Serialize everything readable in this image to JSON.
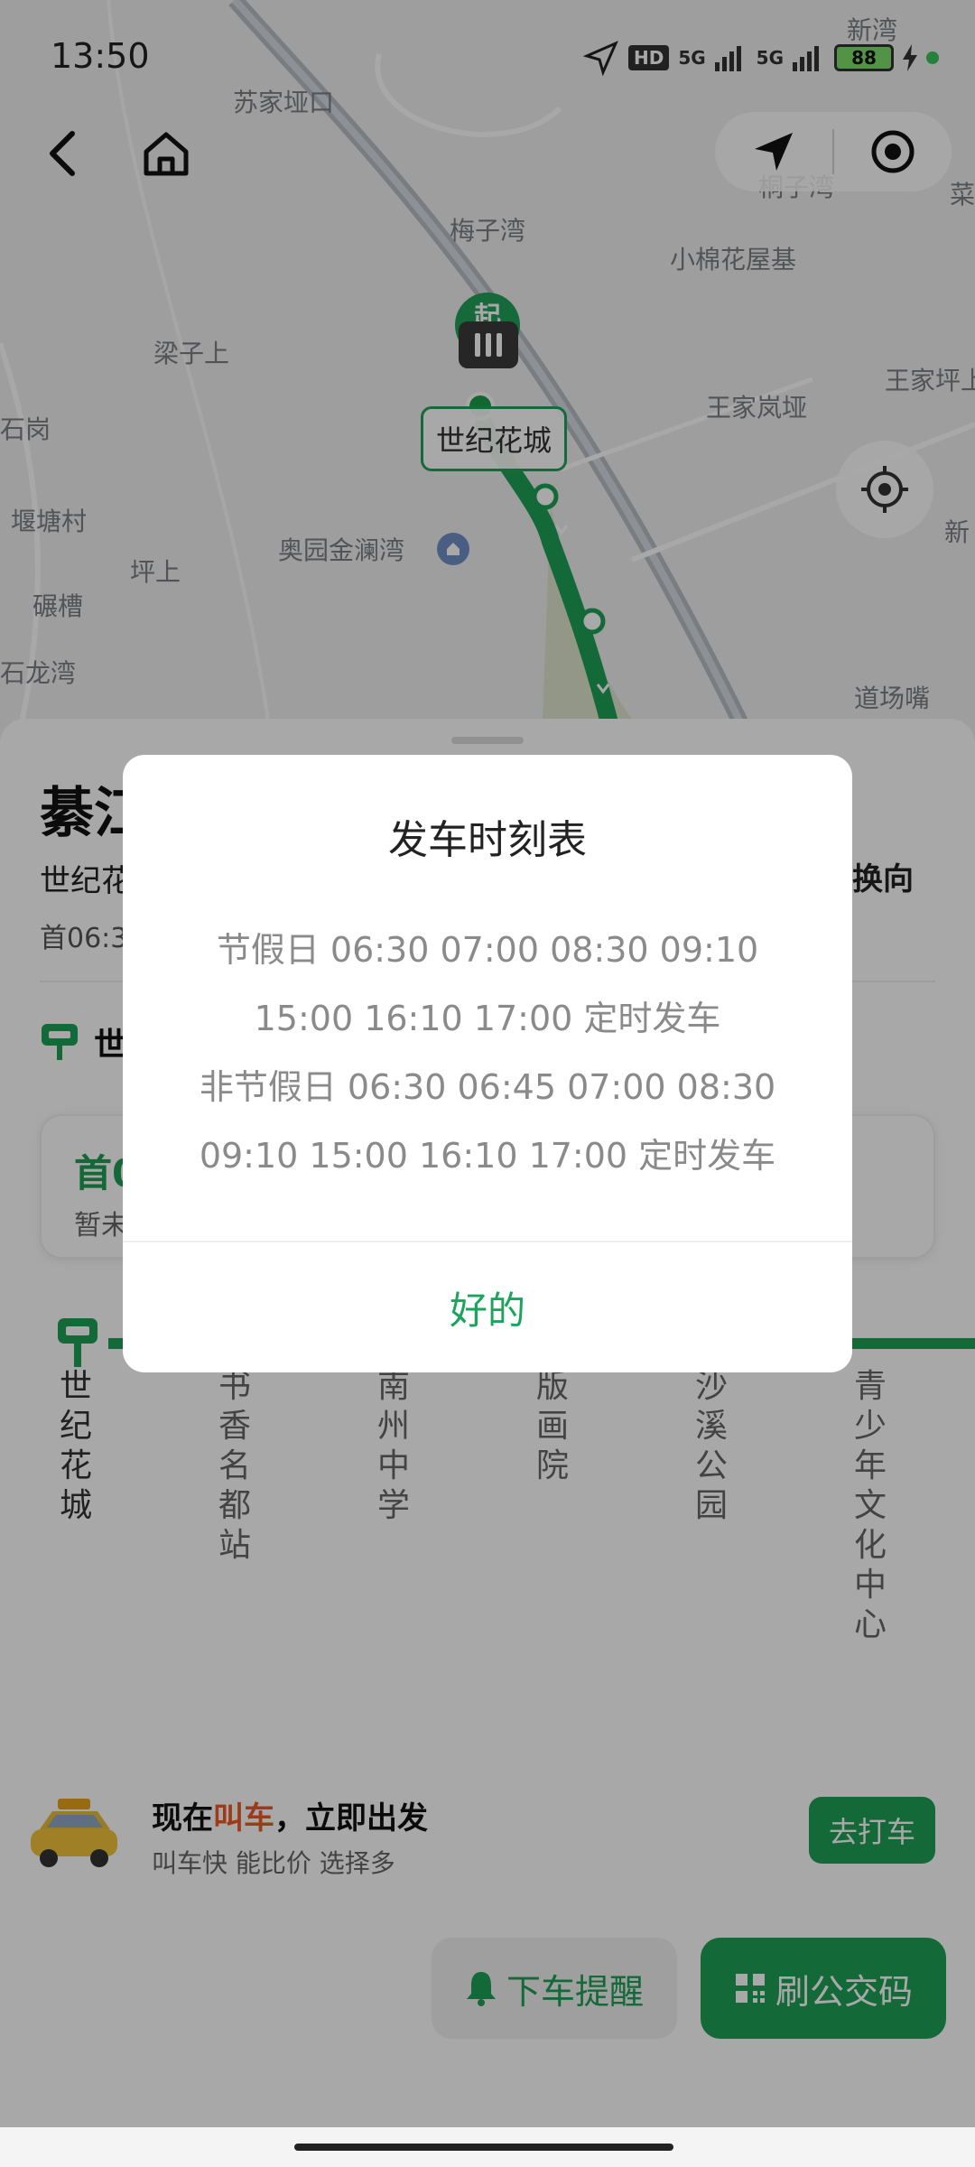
{
  "status_bar": {
    "time": "13:50",
    "net_hd": "HD",
    "net_5g_1": "5G",
    "net_5g_2": "5G",
    "battery": "88"
  },
  "map": {
    "labels": {
      "xinwan": "新湾",
      "sujiaba": "苏家垭口",
      "tongziwan": "桐子湾",
      "meiziwan": "梅子湾",
      "xiaomian": "小棉花屋基",
      "liangzi": "梁子上",
      "wangjia_ping": "王家坪上",
      "wangjialan": "王家岚垭",
      "shigang": "石岗",
      "yantang": "堰塘村",
      "aoyuan": "奥园金澜湾",
      "pingshang": "坪上",
      "nianicao": "碾槽",
      "shilongwan": "石龙湾",
      "daochang": "道场嘴",
      "cai": "菜",
      "xin": "新"
    },
    "start_marker": "起",
    "current_station": "世纪花城"
  },
  "sheet": {
    "route_name": "綦江",
    "route_direction": "世纪花",
    "switch_direction": "换向",
    "first_last": "首06:3",
    "board_stop": "世",
    "arrival_title": "首0",
    "arrival_sub": "暂未",
    "stops": [
      "世纪花城",
      "书香名都站",
      "南州中学",
      "版画院",
      "沙溪公园",
      "青少年文化中心"
    ]
  },
  "taxi": {
    "title_before": "现在",
    "title_highlight": "叫车",
    "title_after": "，立即出发",
    "subtitle": "叫车快 能比价 选择多",
    "button": "去打车"
  },
  "actions": {
    "remind": "下车提醒",
    "qr": "刷公交码"
  },
  "dialog": {
    "title": "发车时刻表",
    "lines": [
      "节假日 06:30 07:00 08:30 09:10",
      "15:00 16:10 17:00 定时发车",
      "非节假日 06:30 06:45 07:00 08:30",
      "09:10 15:00 16:10 17:00 定时发车"
    ],
    "ok": "好的"
  },
  "colors": {
    "accent": "#1fa055",
    "highlight": "#ef5a24",
    "route_line": "#1fa055"
  }
}
